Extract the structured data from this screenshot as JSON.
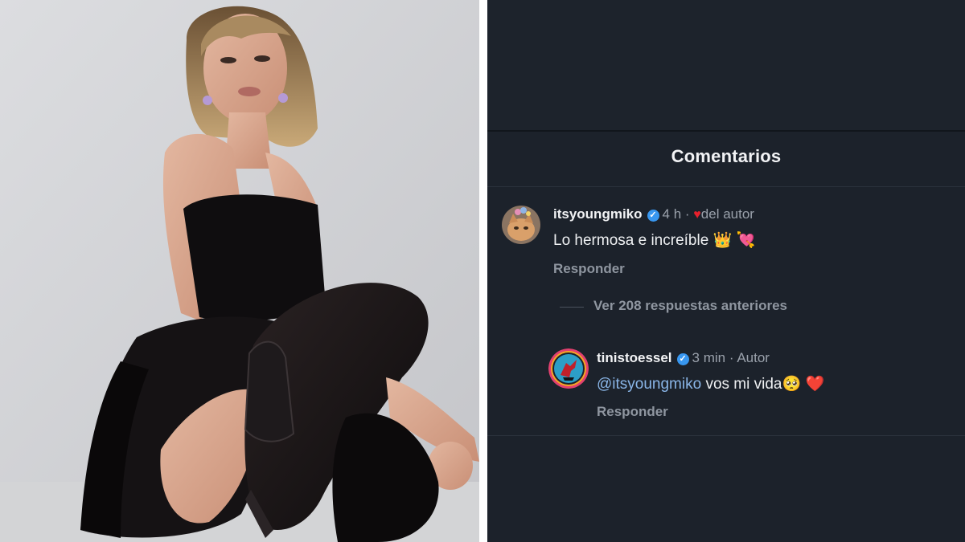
{
  "photo": {
    "alt_subject": "photo-of-woman"
  },
  "comments_sheet": {
    "title": "Comentarios",
    "comments": [
      {
        "username": "itsyoungmiko",
        "verified": true,
        "time": "4 h",
        "separator": "·",
        "liked_by_author_label": "del autor",
        "text": "Lo hermosa e increíble",
        "emojis": [
          "👑",
          "💘"
        ],
        "reply_label": "Responder"
      }
    ],
    "view_more_replies": "Ver 208 respuestas anteriores",
    "reply": {
      "username": "tinistoessel",
      "verified": true,
      "time": "3 min",
      "separator": "·",
      "author_badge": "Autor",
      "mention": "@itsyoungmiko",
      "text": "vos mi vida",
      "emojis": [
        "🥺",
        "❤️"
      ],
      "reply_label": "Responder"
    }
  },
  "colors": {
    "panel_bg": "#1c222b",
    "text_primary": "#f2f3f5",
    "text_secondary": "#9aa1ab",
    "mention": "#8ab6e8",
    "verified": "#3897f0",
    "heart": "#e8202c"
  },
  "icons": {
    "verified": "verified-badge-icon",
    "liked_by_author": "heart-icon"
  }
}
